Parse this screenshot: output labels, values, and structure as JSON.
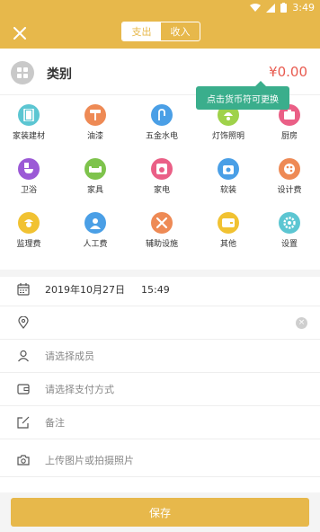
{
  "status_bar": {
    "time": "3:49"
  },
  "toolbar": {
    "tabs": [
      {
        "label": "支出",
        "active": true
      },
      {
        "label": "收入",
        "active": false
      }
    ]
  },
  "category": {
    "label": "类别",
    "amount": "¥0.00"
  },
  "tooltip": {
    "text": "点击货币符可更换"
  },
  "grid": [
    {
      "label": "家装建材",
      "icon": "building-materials-icon",
      "color": "#5cc6d2"
    },
    {
      "label": "油漆",
      "icon": "paint-roller-icon",
      "color": "#ee8a55"
    },
    {
      "label": "五金水电",
      "icon": "faucet-icon",
      "color": "#4a9fe6"
    },
    {
      "label": "灯饰照明",
      "icon": "lamp-icon",
      "color": "#9fd24a"
    },
    {
      "label": "厨房",
      "icon": "kitchen-icon",
      "color": "#ea5f86"
    },
    {
      "label": "卫浴",
      "icon": "toilet-icon",
      "color": "#9b59d6"
    },
    {
      "label": "家具",
      "icon": "sofa-icon",
      "color": "#7ec34c"
    },
    {
      "label": "家电",
      "icon": "appliance-icon",
      "color": "#ea5f86"
    },
    {
      "label": "软装",
      "icon": "soft-decoration-icon",
      "color": "#4a9fe6"
    },
    {
      "label": "设计费",
      "icon": "palette-icon",
      "color": "#ee8a55"
    },
    {
      "label": "监理费",
      "icon": "supervisor-icon",
      "color": "#f1c232"
    },
    {
      "label": "人工费",
      "icon": "worker-icon",
      "color": "#4a9fe6"
    },
    {
      "label": "辅助设施",
      "icon": "tools-icon",
      "color": "#ee8a55"
    },
    {
      "label": "其他",
      "icon": "wallet-icon",
      "color": "#f1c232"
    },
    {
      "label": "设置",
      "icon": "gear-icon",
      "color": "#5cc6d2"
    }
  ],
  "form": {
    "date": "2019年10月27日",
    "time": "15:49",
    "member_placeholder": "请选择成员",
    "payment_placeholder": "请选择支付方式",
    "note_placeholder": "备注",
    "photo_placeholder": "上传图片或拍摄照片"
  },
  "save": {
    "label": "保存"
  }
}
